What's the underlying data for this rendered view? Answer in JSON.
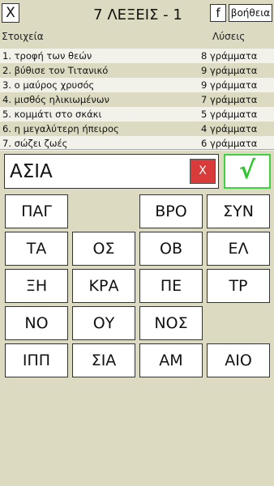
{
  "header": {
    "close_label": "X",
    "title": "7 ΛΕΞΕΙΣ - 1",
    "facebook_label": "f",
    "help_label": "βοήθεια"
  },
  "columns": {
    "clues": "Στοιχεία",
    "solutions": "Λύσεις"
  },
  "clues": [
    {
      "text": "1. τροφή των θεών",
      "solution": "8 γράμματα"
    },
    {
      "text": "2. βύθισε τον Τιτανικό",
      "solution": "9 γράμματα"
    },
    {
      "text": "3. ο μαύρος χρυσός",
      "solution": "9 γράμματα"
    },
    {
      "text": "4. μισθός ηλικιωμένων",
      "solution": "7 γράμματα"
    },
    {
      "text": "5. κομμάτι στο σκάκι",
      "solution": "5 γράμματα"
    },
    {
      "text": "6. η μεγαλύτερη ήπειρος",
      "solution": "4 γράμματα"
    },
    {
      "text": "7. σώζει ζωές",
      "solution": "6 γράμματα"
    }
  ],
  "answer": {
    "value": "ΑΣΙΑ",
    "clear_label": "X",
    "submit_label": "√"
  },
  "tiles": [
    [
      "ΠΑΓ",
      "",
      "ΒΡΟ",
      "ΣΥΝ"
    ],
    [
      "ΤΑ",
      "ΟΣ",
      "ΟΒ",
      "ΕΛ"
    ],
    [
      "ΞΗ",
      "ΚΡΑ",
      "ΠΕ",
      "ΤΡ"
    ],
    [
      "ΝΟ",
      "ΟΥ",
      "ΝΟΣ",
      ""
    ],
    [
      "ΙΠΠ",
      "ΣΙΑ",
      "ΑΜ",
      "ΑΙΟ"
    ]
  ]
}
